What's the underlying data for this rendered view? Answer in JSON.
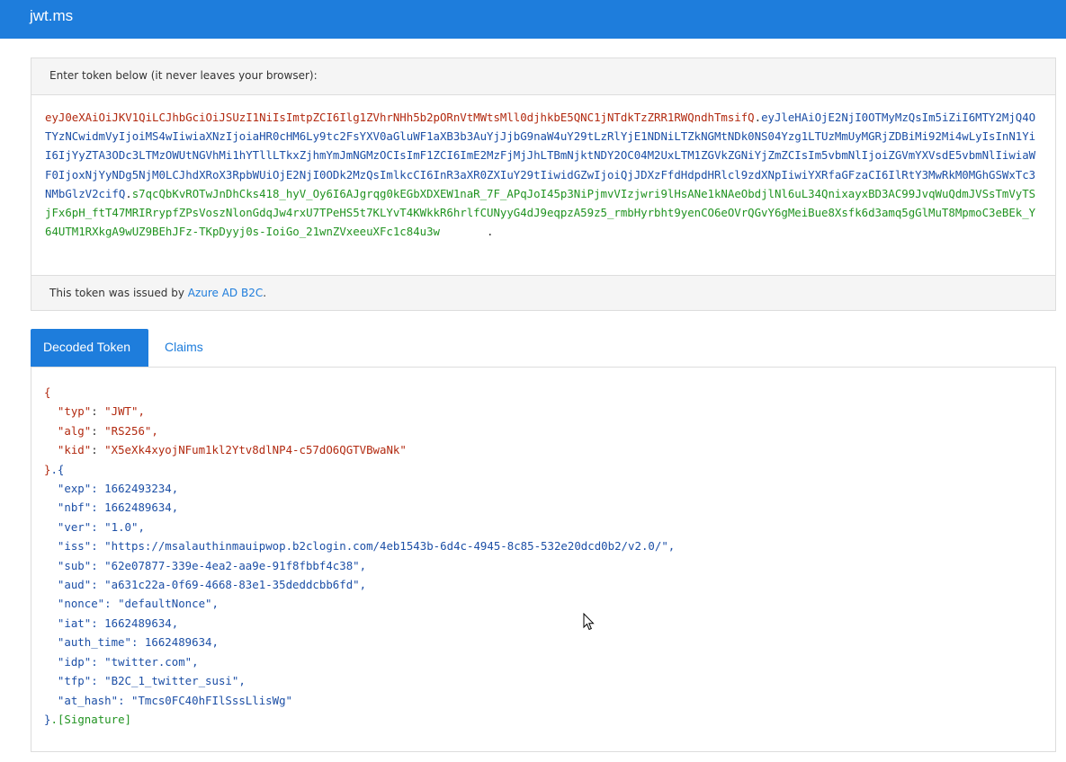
{
  "app": {
    "brand": "jwt.ms"
  },
  "token_panel": {
    "header": "Enter token below (it never leaves your browser):",
    "token_header": "eyJ0eXAiOiJKV1QiLCJhbGciOiJSUzI1NiIsImtpZCI6Ilg1ZVhrNHh5b2pORnVtMWtsMll0djhkbE5QNC1jNTdkTzZRR1RWQndhTmsifQ",
    "token_payload": "eyJleHAiOjE2NjI0OTMyMzQsIm5iZiI6MTY2MjQ4OTYzNCwidmVyIjoiMS4wIiwiaXNzIjoiaHR0cHM6Ly9tc2FsYXV0aGluWF1aXB3b3AuYjJjbG9naW4uY29tLzRlYjE1NDNiLTZkNGMtNDk0NS04Yzg1LTUzMmUyMGRjZDBiMi92Mi4wLyIsInN1YiI6IjYyZTA3ODc3LTMzOWUtNGVhMi1hYTllLTkxZjhmYmJmNGMzOCIsImF1ZCI6ImE2MzFjMjJhLTBmNjktNDY2OC04M2UxLTM1ZGVkZGNiYjZmZCIsIm5vbmNlIjoiZGVmYXVsdE5vbmNlIiwiaWF0IjoxNjYyNDg5NjM0LCJhdXRoX3RpbWUiOjE2NjI0ODk2MzQsImlkcCI6InR3aXR0ZXIuY29tIiwidGZwIjoiQjJDXzFfdHdpdHRlcl9zdXNpIiwiYXRfaGFzaCI6IlRtY3MwRkM0MGhGSWxTc3NMbGlzV2cifQ",
    "token_signature": "s7qcQbKvROTwJnDhCks418_hyV_Oy6I6AJgrqg0kEGbXDXEW1naR_7F_APqJoI45p3NiPjmvVIzjwri9lHsANe1kNAeObdjlNl6uL34QnixayxBD3AC99JvqWuQdmJVSsTmVyTSjFx6pH_ftT47MRIRrypfZPsVoszNlonGdqJw4rxU7TPeHS5t7KLYvT4KWkkR6hrlfCUNyyG4dJ9eqpzA59z5_rmbHyrbht9yenCO6eOVrQGvY6gMeiBue8Xsfk6d3amq5gGlMuT8MpmoC3eBEk_Y64UTM1RXkgA9wUZ9BEhJFz-TKpDyyj0s-IoiGo_21wnZVxeeuXFc1c84u3w",
    "footer_prefix": "This token was issued by ",
    "issuer_link": "Azure AD B2C",
    "footer_suffix": "."
  },
  "tabs": [
    {
      "label": "Decoded Token",
      "active": true
    },
    {
      "label": "Claims",
      "active": false
    }
  ],
  "decoded": {
    "open_brace": "{",
    "header": [
      {
        "key": "\"typ\"",
        "value": "\"JWT\"",
        "sep": ","
      },
      {
        "key": "\"alg\"",
        "value": "\"RS256\"",
        "sep": ","
      },
      {
        "key": "\"kid\"",
        "value": "\"X5eXk4xyojNFum1kl2Ytv8dlNP4-c57dO6QGTVBwaNk\"",
        "sep": ""
      }
    ],
    "middle": "}.{",
    "payload": [
      {
        "key": "\"exp\"",
        "value": "1662493234",
        "sep": ","
      },
      {
        "key": "\"nbf\"",
        "value": "1662489634",
        "sep": ","
      },
      {
        "key": "\"ver\"",
        "value": "\"1.0\"",
        "sep": ","
      },
      {
        "key": "\"iss\"",
        "value": "\"https://msalauthinmauipwop.b2clogin.com/4eb1543b-6d4c-4945-8c85-532e20dcd0b2/v2.0/\"",
        "sep": ","
      },
      {
        "key": "\"sub\"",
        "value": "\"62e07877-339e-4ea2-aa9e-91f8fbbf4c38\"",
        "sep": ","
      },
      {
        "key": "\"aud\"",
        "value": "\"a631c22a-0f69-4668-83e1-35deddcbb6fd\"",
        "sep": ","
      },
      {
        "key": "\"nonce\"",
        "value": "\"defaultNonce\"",
        "sep": ","
      },
      {
        "key": "\"iat\"",
        "value": "1662489634",
        "sep": ","
      },
      {
        "key": "\"auth_time\"",
        "value": "1662489634",
        "sep": ","
      },
      {
        "key": "\"idp\"",
        "value": "\"twitter.com\"",
        "sep": ","
      },
      {
        "key": "\"tfp\"",
        "value": "\"B2C_1_twitter_susi\"",
        "sep": ","
      },
      {
        "key": "\"at_hash\"",
        "value": "\"Tmcs0FC40hFIlSssLlisWg\"",
        "sep": ""
      }
    ],
    "close": "}.",
    "signature": "[Signature]"
  },
  "colors": {
    "accent": "#1e7ddc",
    "header_part": "#b22a10",
    "payload_part": "#1c4fa6",
    "signature_part": "#219321"
  },
  "icons": {
    "cursor": "mouse-pointer-icon"
  }
}
